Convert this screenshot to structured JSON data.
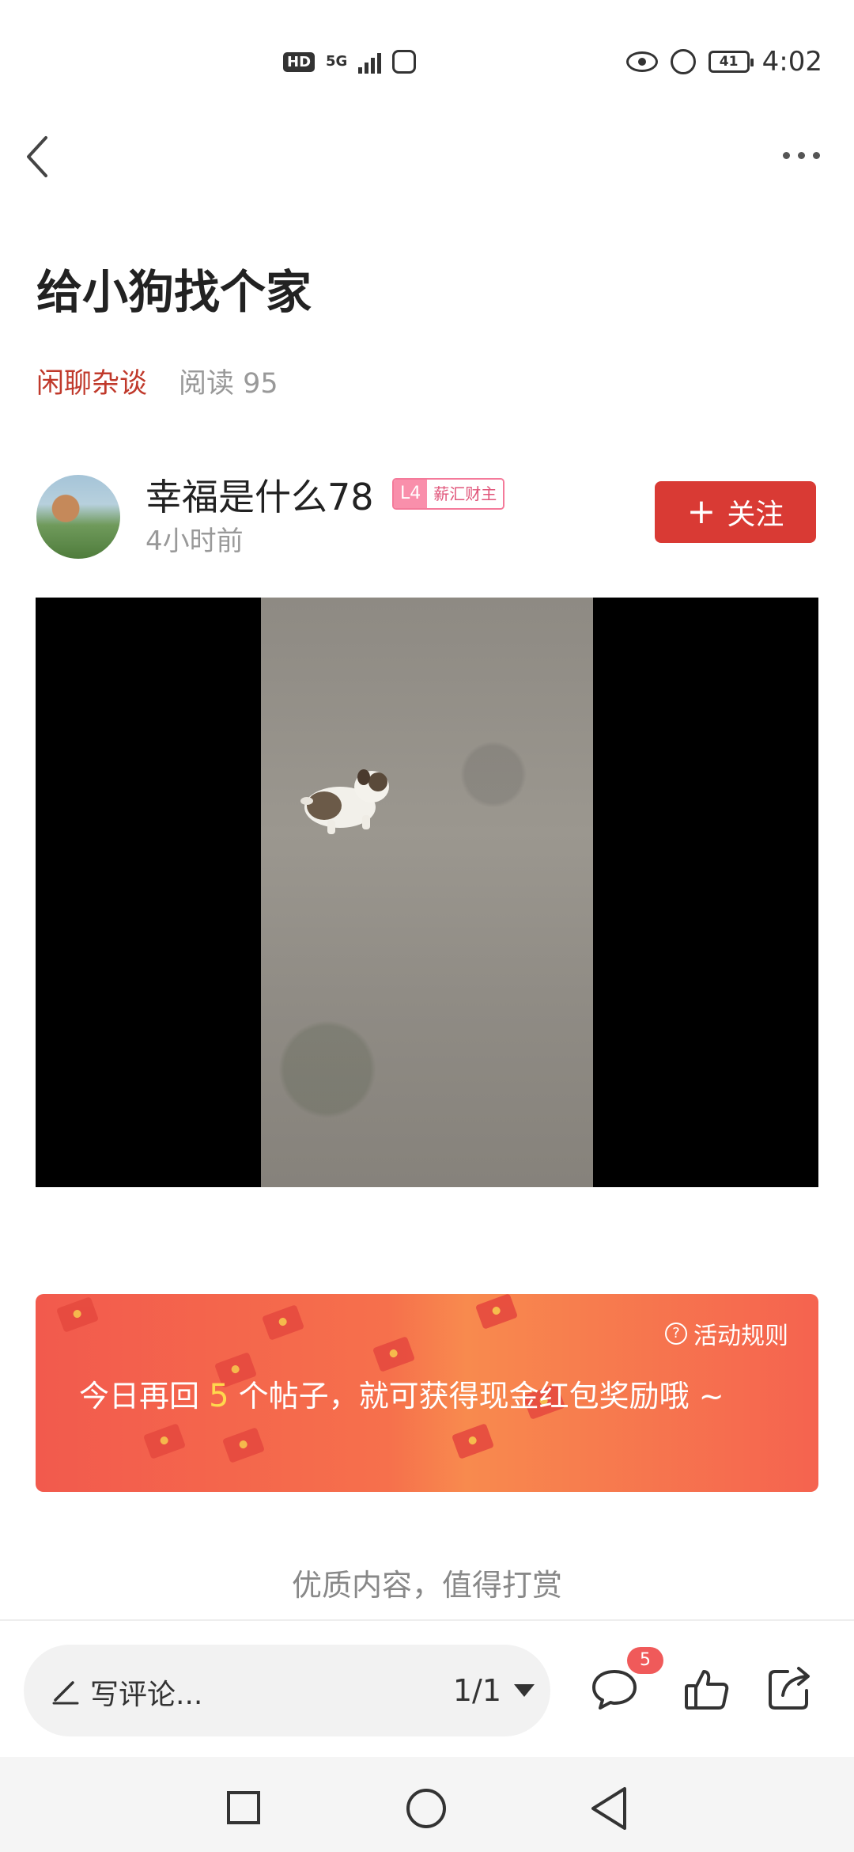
{
  "status_bar": {
    "hd": "HD",
    "network": "5G",
    "battery": "41",
    "time": "4:02"
  },
  "post": {
    "title": "给小狗找个家",
    "category": "闲聊杂谈",
    "reads": "阅读 95"
  },
  "author": {
    "name": "幸福是什么78",
    "level": "L4",
    "level_title": "薪汇财主",
    "time_ago": "4小时前",
    "follow_label": "关注"
  },
  "banner": {
    "rules_label": "活动规则",
    "message_before": "今日再回",
    "count": "5",
    "message_after": "个帖子，就可获得现金红包奖励哦 ~"
  },
  "quality_text": "优质内容，值得打赏",
  "bottom_bar": {
    "comment_placeholder": "写评论...",
    "page_indicator": "1/1",
    "comment_count": "5"
  },
  "colors": {
    "accent": "#d93a34",
    "category": "#c0392b",
    "banner_highlight": "#ffd84d"
  }
}
